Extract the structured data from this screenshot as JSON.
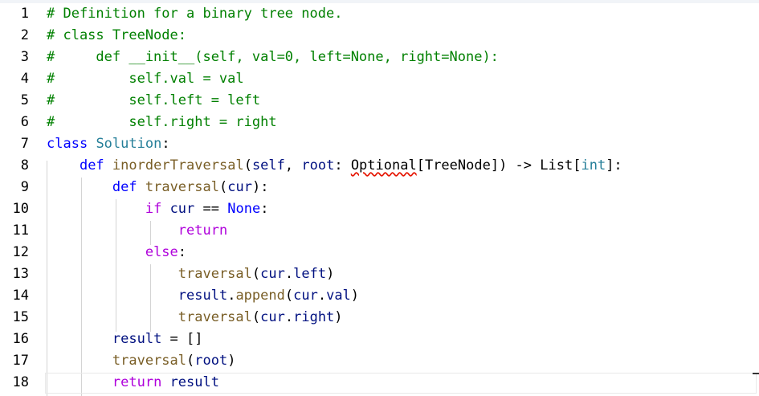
{
  "editor": {
    "lines": [
      {
        "n": "1",
        "t": [
          "# Definition for a binary tree node."
        ]
      },
      {
        "n": "2",
        "t": [
          "# class TreeNode:"
        ]
      },
      {
        "n": "3",
        "t": [
          "#     def __init__(self, val=0, left=None, right=None):"
        ]
      },
      {
        "n": "4",
        "t": [
          "#         self.val = val"
        ]
      },
      {
        "n": "5",
        "t": [
          "#         self.left = left"
        ]
      },
      {
        "n": "6",
        "t": [
          "#         self.right = right"
        ]
      },
      {
        "n": "7",
        "t": [
          "class",
          " ",
          "Solution",
          ":"
        ]
      },
      {
        "n": "8",
        "t": [
          "    ",
          "def",
          " ",
          "inorderTraversal",
          "(",
          "self",
          ", ",
          "root",
          ": ",
          "Optional",
          "[",
          "TreeNode",
          "]) -> ",
          "List",
          "[",
          "int",
          "]:"
        ]
      },
      {
        "n": "9",
        "t": [
          "        ",
          "def",
          " ",
          "traversal",
          "(",
          "cur",
          "):"
        ]
      },
      {
        "n": "10",
        "t": [
          "            ",
          "if",
          " ",
          "cur",
          " == ",
          "None",
          ":"
        ]
      },
      {
        "n": "11",
        "t": [
          "                ",
          "return"
        ]
      },
      {
        "n": "12",
        "t": [
          "            ",
          "else",
          ":"
        ]
      },
      {
        "n": "13",
        "t": [
          "                ",
          "traversal",
          "(",
          "cur",
          ".",
          "left",
          ")"
        ]
      },
      {
        "n": "14",
        "t": [
          "                ",
          "result",
          ".",
          "append",
          "(",
          "cur",
          ".",
          "val",
          ")"
        ]
      },
      {
        "n": "15",
        "t": [
          "                ",
          "traversal",
          "(",
          "cur",
          ".",
          "right",
          ")"
        ]
      },
      {
        "n": "16",
        "t": [
          "        ",
          "result",
          " = []"
        ]
      },
      {
        "n": "17",
        "t": [
          "        ",
          "traversal",
          "(",
          "root",
          ")"
        ]
      },
      {
        "n": "18",
        "t": [
          "        ",
          "return",
          " ",
          "result"
        ]
      }
    ]
  },
  "colors": {
    "comment": "#008000",
    "keyword": "#0000ff",
    "control": "#af00db",
    "function": "#795e26",
    "class": "#267f99",
    "identifier": "#001080",
    "error_squiggle": "#e51400"
  }
}
